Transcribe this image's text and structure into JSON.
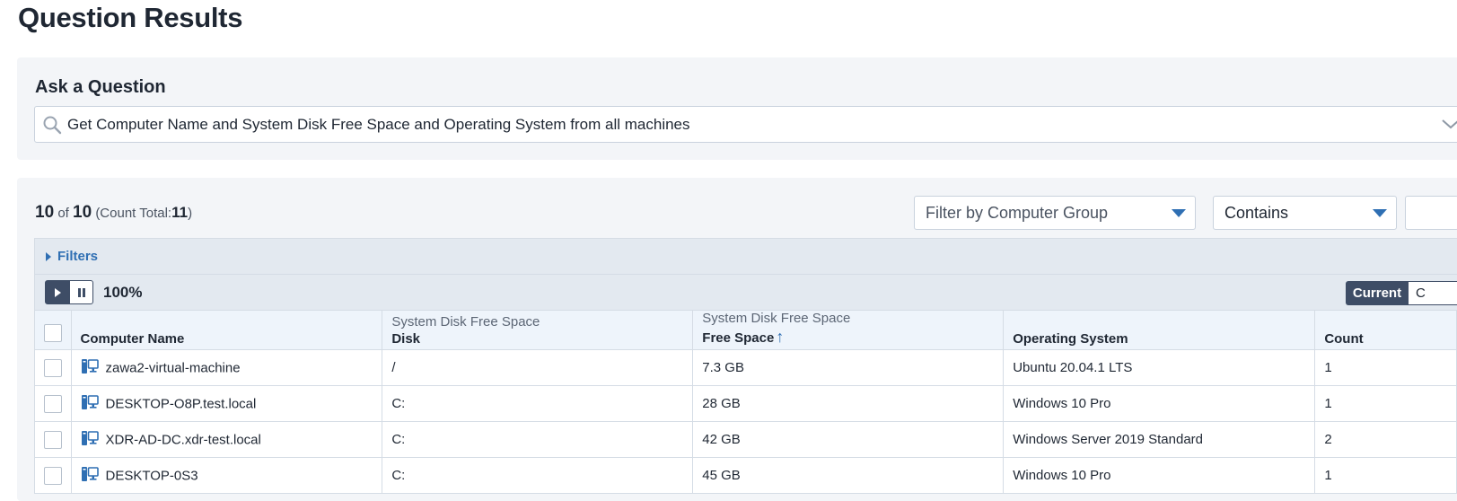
{
  "page": {
    "title": "Question Results"
  },
  "ask": {
    "title": "Ask a Question",
    "question": "Get Computer Name and System Disk Free Space and Operating System from all machines"
  },
  "results": {
    "shown": "10",
    "of_label": "of",
    "total_shown": "10",
    "count_total_label": "(Count Total:",
    "count_total": "11",
    "count_total_close": ")"
  },
  "filters": {
    "computer_group_label": "Filter by Computer Group",
    "match_label": "Contains",
    "filters_label": "Filters"
  },
  "toolbar": {
    "progress": "100%",
    "current_label": "Current",
    "other_label": "C"
  },
  "table": {
    "columns": [
      {
        "group": "",
        "label": "Computer Name"
      },
      {
        "group": "System Disk Free Space",
        "label": "Disk"
      },
      {
        "group": "System Disk Free Space",
        "label": "Free Space",
        "sorted": "ascending"
      },
      {
        "group": "",
        "label": "Operating System"
      },
      {
        "group": "",
        "label": "Count"
      }
    ],
    "rows": [
      {
        "computer": "zawa2-virtual-machine",
        "disk": "/",
        "free": "7.3 GB",
        "os": "Ubuntu 20.04.1 LTS",
        "count": "1"
      },
      {
        "computer": "DESKTOP-O8P.test.local",
        "disk": "C:",
        "free": "28 GB",
        "os": "Windows 10 Pro",
        "count": "1"
      },
      {
        "computer": "XDR-AD-DC.xdr-test.local",
        "disk": "C:",
        "free": "42 GB",
        "os": "Windows Server 2019 Standard",
        "count": "2"
      },
      {
        "computer": "DESKTOP-0S3",
        "disk": "C:",
        "free": "45 GB",
        "os": "Windows 10 Pro",
        "count": "1"
      }
    ]
  },
  "colors": {
    "accent": "#2f6fb3",
    "dark": "#3e4d66",
    "panel": "#f3f5f8"
  },
  "icons": {
    "search": "search-icon",
    "chevron": "chevron-down-icon",
    "computer": "computer-icon",
    "sort": "sort-asc-icon"
  }
}
